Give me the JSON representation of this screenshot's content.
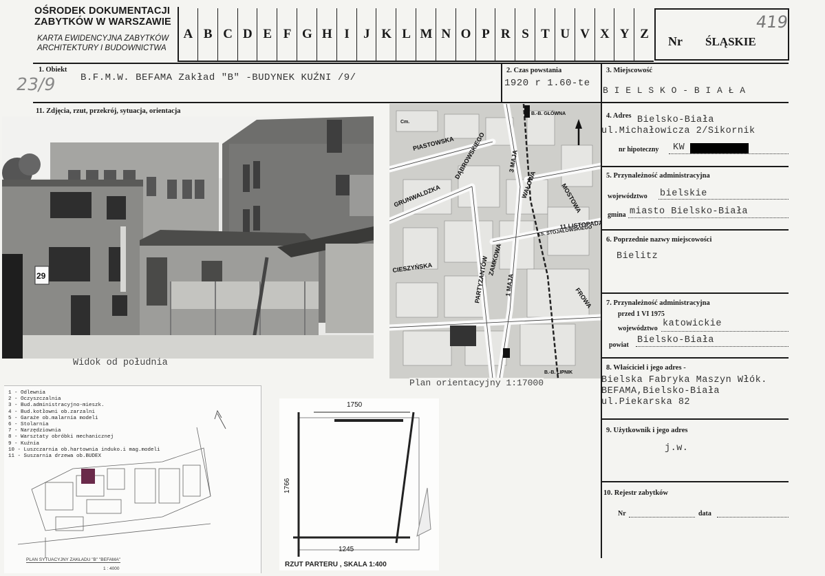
{
  "header": {
    "org_line1": "OŚRODEK DOKUMENTACJI",
    "org_line2": "ZABYTKÓW W WARSZAWIE",
    "card_line1": "KARTA EWIDENCYJNA ZABYTKÓW",
    "card_line2": "ARCHITEKTURY I BUDOWNICTWA",
    "letters": [
      "A",
      "B",
      "C",
      "D",
      "E",
      "F",
      "G",
      "H",
      "I",
      "J",
      "K",
      "L",
      "M",
      "N",
      "O",
      "P",
      "R",
      "S",
      "T",
      "U",
      "V",
      "X",
      "Y",
      "Z"
    ],
    "nr_label": "Nr",
    "region": "ŚLĄSKIE",
    "card_number": "419"
  },
  "obiekt": {
    "label": "1. Obiekt",
    "handwritten": "23/9",
    "value": "B.F.M.W. BEFAMA Zakład \"B\" -BUDYNEK KUŹNI /9/"
  },
  "czas": {
    "label": "2. Czas powstania",
    "value": "1920 r 1.60-te"
  },
  "miejscowosc": {
    "label": "3. Miejscowość",
    "value": "B I E L S K O - B I A Ł A"
  },
  "adres": {
    "label": "4. Adres",
    "line1": "Bielsko-Biała",
    "line2": "ul.Michałowicza 2/Sikornik",
    "hipoteczny_label": "nr hipoteczny",
    "hipoteczny_value": "KW"
  },
  "przynaleznosc": {
    "label": "5. Przynależność administracyjna",
    "woj_label": "województwo",
    "woj_value": "bielskie",
    "gmina_label": "gmina",
    "gmina_value": "miasto Bielsko-Biała"
  },
  "poprzednie": {
    "label": "6. Poprzednie nazwy miejscowości",
    "value": "Bielitz"
  },
  "przynaleznosc1975": {
    "label": "7. Przynależność administracyjna",
    "sublabel": "przed 1 VI 1975",
    "woj_label": "województwo",
    "woj_value": "katowickie",
    "powiat_label": "powiat",
    "powiat_value": "Bielsko-Biała"
  },
  "wlasciciel": {
    "label": "8. Właściciel i jego adres",
    "line1": "Bielska Fabryka Maszyn Włók.",
    "line2": "BEFAMA,Bielsko-Biała",
    "line3": "ul.Piekarska 82"
  },
  "uzytkownik": {
    "label": "9. Użytkownik i jego adres",
    "value": "j.w."
  },
  "rejestr": {
    "label": "10. Rejestr zabytków",
    "nr_label": "Nr",
    "data_label": "data"
  },
  "zdjecia": {
    "label": "11. Zdjęcia, rzut, przekrój, sytuacja, orientacja",
    "photo_caption": "Widok od południa",
    "photo_sign": "29",
    "map_caption": "Plan orientacyjny 1:17000",
    "map_streets": [
      "PIASTOWSKA",
      "GRUNWALDZKA",
      "DĄBROWSKIEGO",
      "WAŁOWA",
      "MOSTOWA",
      "11 LISTOPADA",
      "CIESZYŃSKA",
      "ZAMKOWA",
      "3 MAJA",
      "1 MAJA",
      "PARTYZANTÓW",
      "KS. STOJAŁOWSKIEGO",
      "FROWA"
    ],
    "map_labels": [
      "B.-B. GŁÓWNA",
      "B.-B. LIPNIK",
      "Cm."
    ]
  },
  "site_plan": {
    "legend": [
      "1  - Odlewnia",
      "2  - Oczyszczalnia",
      "3  - Bud.administracyjno-mieszk.",
      "4  - Bud.kotłowni ob.zarzalni",
      "5  - Garaże ob.malarnia modeli",
      "6  - Stolarnia",
      "7  - Narzędziownia",
      "8  - Warsztaty obróbki mechanicznej",
      "9  - Kuźnia",
      "10 - Luszczarnia ob.hartownia induko.i mag.modeli",
      "11 - Suszarnia drzewa ob.BUDEX"
    ],
    "caption": "PLAN SYTUACYJNY ZAKŁADU \"B\" \"BEFAMA\"",
    "scale": "1 : 4000"
  },
  "floor_plan": {
    "dim_top": "1750",
    "dim_side": "1766",
    "dim_bottom": "1245",
    "caption": "RZUT PARTERU , SKALA 1:400"
  }
}
